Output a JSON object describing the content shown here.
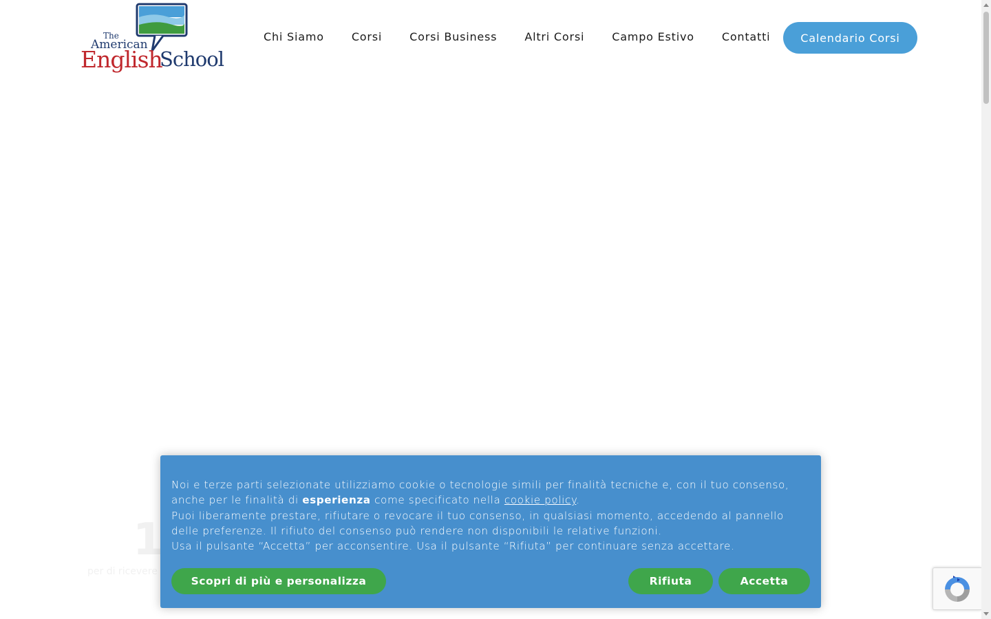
{
  "logo": {
    "line_the": "The",
    "line_american": "American",
    "line_english": "English",
    "line_school": "School"
  },
  "nav": {
    "items": [
      {
        "label": "Chi Siamo"
      },
      {
        "label": "Corsi"
      },
      {
        "label": "Corsi Business"
      },
      {
        "label": "Altri Corsi"
      },
      {
        "label": "Campo Estivo"
      },
      {
        "label": "Contatti"
      }
    ],
    "cta_label": "Calendario Corsi"
  },
  "background_hint": {
    "big": "1",
    "small": "per di ricevere"
  },
  "cookie_banner": {
    "p1_a": "Noi e terze parti selezionate utilizziamo cookie o tecnologie simili per finalità tecniche e, con il tuo consenso, anche per le finalità di ",
    "p1_bold": "esperienza",
    "p1_b": " come specificato nella ",
    "p1_link": "cookie policy",
    "p1_c": ".",
    "p2": "Puoi liberamente prestare, rifiutare o revocare il tuo consenso, in qualsiasi momento, accedendo al pannello delle preferenze. Il rifiuto del consenso può rendere non disponibili le relative funzioni.",
    "p3": "Usa il pulsante “Accetta” per acconsentire. Usa il pulsante “Rifiuta” per continuare senza accettare.",
    "btn_more": "Scopri di più e personalizza",
    "btn_reject": "Rifiuta",
    "btn_accept": "Accetta"
  },
  "colors": {
    "accent_blue": "#4a9fd8",
    "banner_blue": "#478fcd",
    "button_green": "#3fa64b",
    "logo_red": "#c0282d",
    "logo_navy": "#1f3a6e"
  },
  "icons": {
    "recaptcha": "recaptcha-icon"
  }
}
